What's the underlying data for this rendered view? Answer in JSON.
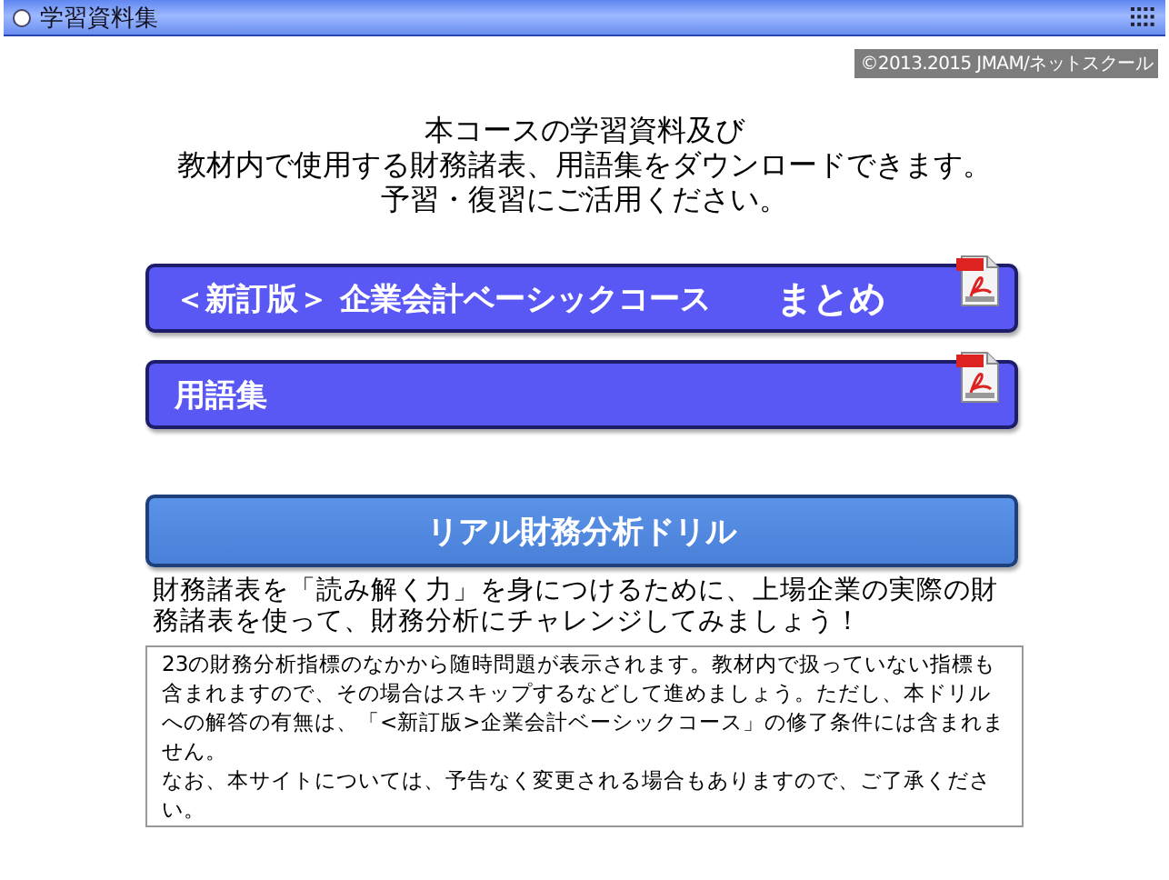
{
  "window": {
    "title": "学習資料集"
  },
  "copyright": "©2013.2015 JMAM/ネットスクール",
  "intro": [
    "本コースの学習資料及び",
    "教材内で使用する財務諸表、用語集をダウンロードできます。",
    "予習・復習にご活用ください。"
  ],
  "downloads": [
    {
      "label": "＜新訂版＞ 企業会計ベーシックコース",
      "suffix": "まとめ"
    },
    {
      "label": "用語集"
    }
  ],
  "drill": {
    "title": "リアル財務分析ドリル",
    "description": "財務諸表を「読み解く力」を身につけるために、上場企業の実際の財務諸表を使って、財務分析にチャレンジしてみましょう！",
    "notes": [
      "23の財務分析指標のなかから随時問題が表示されます。教材内で扱っていない指標も含まれますので、その場合はスキップするなどして進めましょう。ただし、本ドリルへの解答の有無は、「<新訂版>企業会計ベーシックコース」の修了条件には含まれません。",
      "なお、本サイトについては、予告なく変更される場合もありますので、ご了承ください。"
    ]
  }
}
